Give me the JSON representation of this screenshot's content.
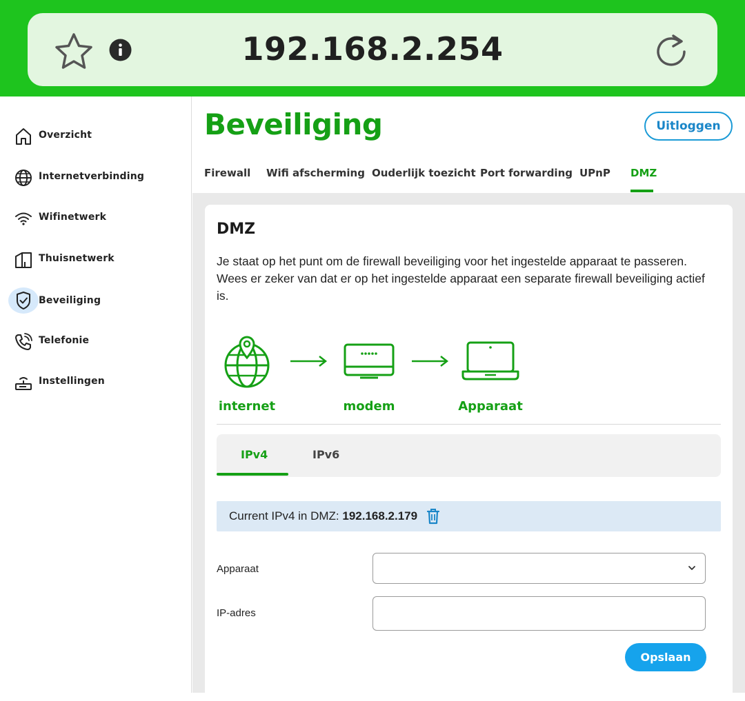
{
  "browser": {
    "url": "192.168.2.254"
  },
  "sidebar": {
    "items": [
      {
        "label": "Overzicht",
        "icon": "home-icon"
      },
      {
        "label": "Internetverbinding",
        "icon": "globe-icon"
      },
      {
        "label": "Wifinetwerk",
        "icon": "wifi-icon"
      },
      {
        "label": "Thuisnetwerk",
        "icon": "house-network-icon"
      },
      {
        "label": "Beveiliging",
        "icon": "shield-check-icon",
        "active": true
      },
      {
        "label": "Telefonie",
        "icon": "phone-icon"
      },
      {
        "label": "Instellingen",
        "icon": "router-icon"
      }
    ]
  },
  "header": {
    "title": "Beveiliging",
    "logout_label": "Uitloggen",
    "tabs": [
      {
        "label": "Firewall"
      },
      {
        "label": "Wifi afscherming"
      },
      {
        "label": "Ouderlijk toezicht"
      },
      {
        "label": "Port forwarding"
      },
      {
        "label": "UPnP"
      },
      {
        "label": "DMZ",
        "active": true
      }
    ]
  },
  "card": {
    "title": "DMZ",
    "description": "Je staat op het punt om de firewall beveiliging voor het ingestelde apparaat te passeren. Wees er zeker van dat er op het ingestelde apparaat een separate firewall beveiliging actief is.",
    "diagram": {
      "internet_label": "internet",
      "modem_label": "modem",
      "device_label": "Apparaat"
    },
    "ip_tabs": [
      {
        "label": "IPv4",
        "active": true
      },
      {
        "label": "IPv6"
      }
    ],
    "dmz_info": {
      "label": "Current IPv4 in DMZ: ",
      "ip": "192.168.2.179"
    },
    "form": {
      "device_label": "Apparaat",
      "device_value": "",
      "ip_label": "IP-adres",
      "ip_value": "",
      "save_label": "Opslaan"
    }
  },
  "colors": {
    "brand_green": "#15a015",
    "topbar_green": "#1ec41e",
    "accent_blue": "#16a3ec"
  }
}
